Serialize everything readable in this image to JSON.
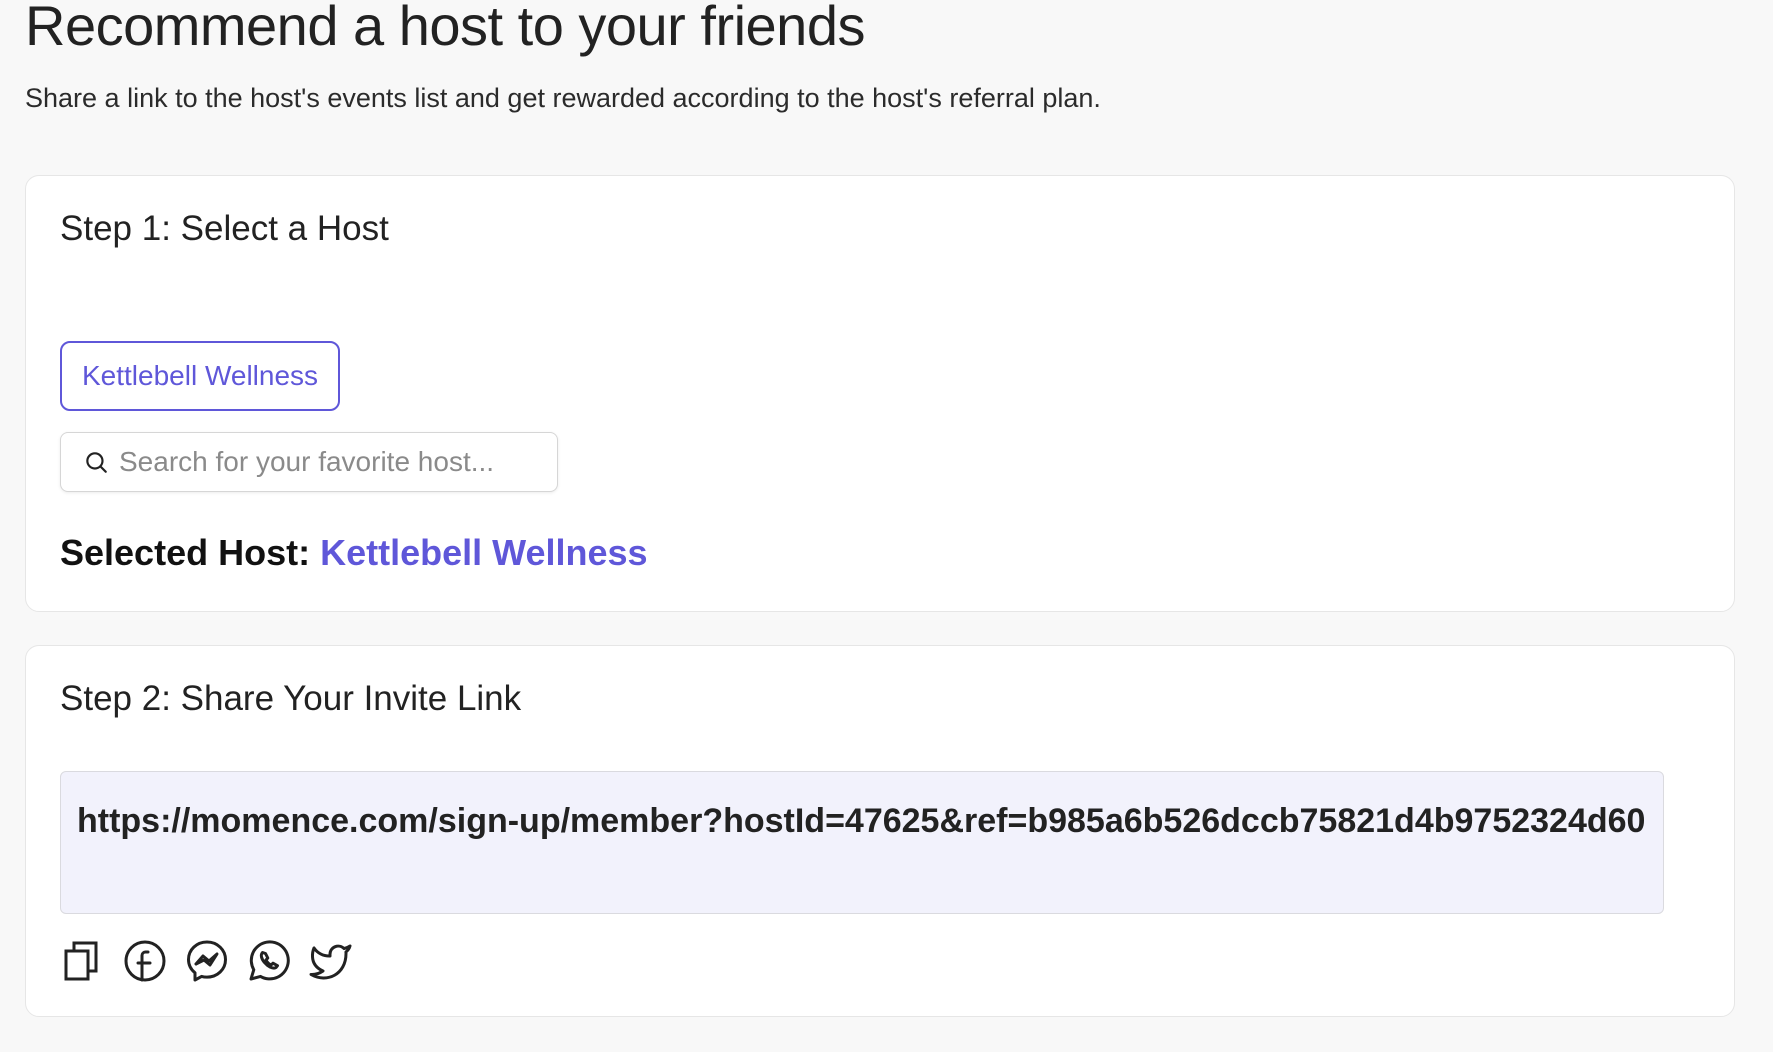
{
  "header": {
    "title": "Recommend a host to your friends",
    "subtitle": "Share a link to the host's events list and get rewarded according to the host's referral plan."
  },
  "step1": {
    "heading": "Step 1: Select a Host",
    "host_chip_label": "Kettlebell Wellness",
    "search": {
      "placeholder": "Search for your favorite host...",
      "value": ""
    },
    "selected_host_label": "Selected Host:",
    "selected_host_value": "Kettlebell Wellness"
  },
  "step2": {
    "heading": "Step 2: Share Your Invite Link",
    "invite_link": "https://momence.com/sign-up/member?hostId=47625&ref=b985a6b526dccb75821d4b9752324d60",
    "share_icons": [
      "copy-icon",
      "facebook-icon",
      "messenger-icon",
      "whatsapp-icon",
      "twitter-icon"
    ]
  },
  "colors": {
    "accent": "#5f57d9",
    "background": "#f8f8f8",
    "card": "#ffffff",
    "link_box": "#f2f2fc"
  }
}
